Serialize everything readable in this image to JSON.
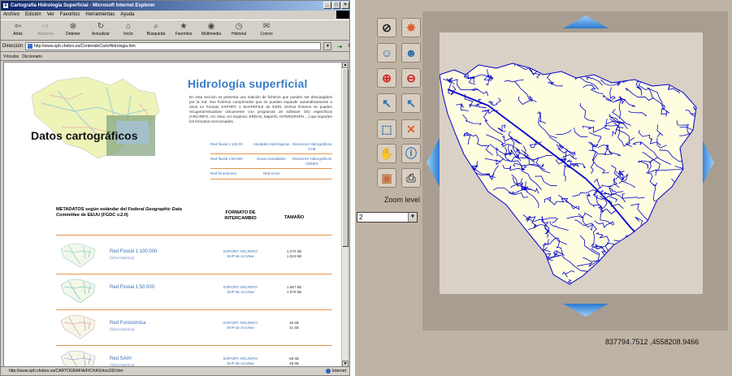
{
  "browser": {
    "title": "Cartografía Hidrología Superficial - Microsoft Internet Explorer",
    "window_buttons": [
      "_",
      "□",
      "×"
    ],
    "menu": [
      "Archivo",
      "Edición",
      "Ver",
      "Favoritos",
      "Herramientas",
      "Ayuda"
    ],
    "toolbar": [
      {
        "label": "Atrás",
        "icon": "back-arrow-icon",
        "glyph": "⇦",
        "enabled": true
      },
      {
        "label": "Adelante",
        "icon": "forward-arrow-icon",
        "glyph": "⇨",
        "enabled": false
      },
      {
        "label": "Detener",
        "icon": "stop-icon",
        "glyph": "⊗",
        "enabled": true
      },
      {
        "label": "Actualizar",
        "icon": "refresh-icon",
        "glyph": "↻",
        "enabled": true
      },
      {
        "label": "Inicio",
        "icon": "home-icon",
        "glyph": "⌂",
        "enabled": true
      },
      {
        "label": "Búsqueda",
        "icon": "search-icon",
        "glyph": "⌕",
        "enabled": true
      },
      {
        "label": "Favoritos",
        "icon": "favorites-icon",
        "glyph": "★",
        "enabled": true
      },
      {
        "label": "Multimedia",
        "icon": "media-icon",
        "glyph": "◉",
        "enabled": true
      },
      {
        "label": "Historial",
        "icon": "history-icon",
        "glyph": "◷",
        "enabled": true
      },
      {
        "label": "Correo",
        "icon": "mail-icon",
        "glyph": "✉",
        "enabled": true
      }
    ],
    "address_label": "Dirección",
    "address": "http://www.oph.chebro.es/ContenidoCartoHidrologia.htm",
    "go_label": "Ir",
    "links_label": "Vínculos",
    "links": [
      "Diccionario"
    ],
    "status_url": "http://www.oph.chebro.es/CARTOGRAFIA/FICHAS/rios100.htm",
    "status_zone": "Internet"
  },
  "page": {
    "hero_title": "Datos cartográficos",
    "heading": "Hidrología superficial",
    "intro": "En esta sección se presenta una relación de ficheros que pueden ser descargados por la red. Son ficheros comprimidos que se pueden expandir automáticamente a otros en formato EXPORT o SHAPEFILE de ESRI. Dichos ficheros se pueden recuperar/visualizar únicamente con programas de software SIG específicos (ARC/INFO, Arc View, Arc Explorer, ERDAS, MapInfo, INTERGRAPH ...) que soporten los formatos mencionados.",
    "link_rows": [
      [
        "Red fluvial 1:100.00",
        "Unidades Hidrológicas",
        "Divisiones Hidrográficas CHE"
      ],
      [
        "Red fluvial 1:50.000",
        "Zonas inundables",
        "Divisiones Hidrográficas CEDEX"
      ],
      [
        "Red foronómica",
        "Red SAIH",
        ""
      ]
    ],
    "meta_header": {
      "col1_a": "METADATOS según estándar del ",
      "col1_b": "Federal Geographic Data Committee",
      "col1_c": " de EEUU (FGDC v.2.0)",
      "col2": "FORMATO DE INTERCAMBIO",
      "col3": "TAMAÑO"
    },
    "datasets": [
      {
        "name": "Red Fluvial 1:100.000",
        "sub": "(ficha histórica)",
        "fmt1": "EXPORT ARC/INFO",
        "fmt2": "SHP de ArcView",
        "size1": "1.270 kB",
        "size2": "1.024 kB",
        "color": "#8fd3d0"
      },
      {
        "name": "Red Fluvial 1:50.000",
        "sub": "",
        "fmt1": "EXPORT ARC/INFO",
        "fmt2": "SHP de ArcView",
        "size1": "1.657 kB",
        "size2": "1.579 kB",
        "color": "#7fc9c6"
      },
      {
        "name": "Red Foronómica",
        "sub": "(ficha histórica)",
        "fmt1": "EXPORT ARC/INFO",
        "fmt2": "SHP de ArcView",
        "size1": "46 kB",
        "size2": "41 kB",
        "color": "#e5a6a6"
      },
      {
        "name": "Red SAIH",
        "sub": "(ficha histórica)",
        "fmt1": "EXPORT ARC/INFO",
        "fmt2": "SHP de ArcView",
        "size1": "68 kB",
        "size2": "49 kB",
        "color": "#a8a8d8"
      }
    ]
  },
  "viewer": {
    "tools": [
      {
        "name": "clear-selection-icon",
        "glyph": "⊘",
        "color": "#222222"
      },
      {
        "name": "refresh-map-icon",
        "glyph": "✸",
        "color": "#e06030"
      },
      {
        "name": "identify-user-icon",
        "glyph": "☺",
        "color": "#2a6fb0"
      },
      {
        "name": "select-user-icon",
        "glyph": "☻",
        "color": "#2a6fb0"
      },
      {
        "name": "zoom-in-icon",
        "glyph": "⊕",
        "color": "#d02020"
      },
      {
        "name": "zoom-out-icon",
        "glyph": "⊖",
        "color": "#d02020"
      },
      {
        "name": "pointer-plus-icon",
        "glyph": "↖",
        "color": "#2a6fb0"
      },
      {
        "name": "pointer-minus-icon",
        "glyph": "↖",
        "color": "#2a6fb0"
      },
      {
        "name": "select-box-icon",
        "glyph": "⬚",
        "color": "#2a6fb0"
      },
      {
        "name": "clear-x-icon",
        "glyph": "✕",
        "color": "#e06030"
      },
      {
        "name": "pan-hand-icon",
        "glyph": "✋",
        "color": "#555555"
      },
      {
        "name": "info-icon",
        "glyph": "ⓘ",
        "color": "#2a6fb0"
      },
      {
        "name": "folder-icon",
        "glyph": "▣",
        "color": "#c07040"
      },
      {
        "name": "print-icon",
        "glyph": "⎙",
        "color": "#555555"
      }
    ],
    "zoom_label": "Zoom level",
    "zoom_value": "2",
    "coordinates": "837794.7512 ,4558208.9466",
    "colors": {
      "rivers": "#0000cc",
      "land": "#fffde0",
      "frame": "#a89d90",
      "panel": "#bfb3a4"
    }
  }
}
